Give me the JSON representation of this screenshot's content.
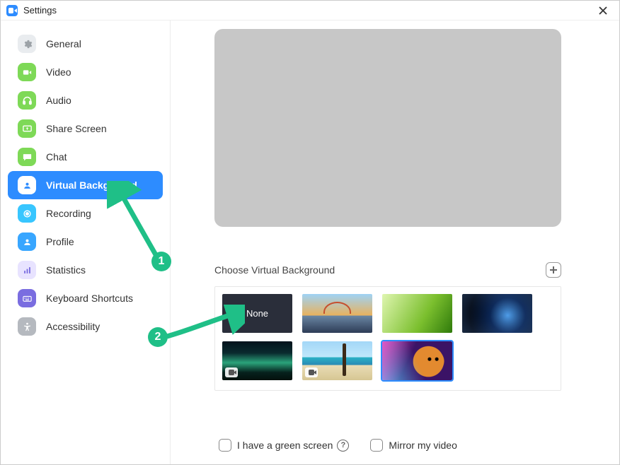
{
  "window": {
    "title": "Settings"
  },
  "sidebar": {
    "items": [
      {
        "label": "General",
        "bg": "#e9ecef",
        "fg": "#9da3a8",
        "name": "general"
      },
      {
        "label": "Video",
        "bg": "#7ed957",
        "fg": "#ffffff",
        "name": "video"
      },
      {
        "label": "Audio",
        "bg": "#7ed957",
        "fg": "#ffffff",
        "name": "audio"
      },
      {
        "label": "Share Screen",
        "bg": "#7ed957",
        "fg": "#ffffff",
        "name": "share-screen"
      },
      {
        "label": "Chat",
        "bg": "#7ed957",
        "fg": "#ffffff",
        "name": "chat"
      },
      {
        "label": "Virtual Background",
        "bg": "#ffffff",
        "fg": "#2d8cff",
        "name": "virtual-background",
        "selected": true
      },
      {
        "label": "Recording",
        "bg": "#38c6ff",
        "fg": "#ffffff",
        "name": "recording"
      },
      {
        "label": "Profile",
        "bg": "#38a6ff",
        "fg": "#ffffff",
        "name": "profile"
      },
      {
        "label": "Statistics",
        "bg": "#e8e3ff",
        "fg": "#7a6de0",
        "name": "statistics"
      },
      {
        "label": "Keyboard Shortcuts",
        "bg": "#7a6de0",
        "fg": "#ffffff",
        "name": "keyboard-shortcuts"
      },
      {
        "label": "Accessibility",
        "bg": "#b5b9bf",
        "fg": "#ffffff",
        "name": "accessibility"
      }
    ]
  },
  "content": {
    "section_title": "Choose Virtual Background",
    "none_label": "None",
    "thumbs": {
      "row1": [
        {
          "name": "bg-none",
          "kind": "none"
        },
        {
          "name": "bg-bridge",
          "class": "th-bridge"
        },
        {
          "name": "bg-grass",
          "class": "th-grass"
        },
        {
          "name": "bg-earth",
          "class": "th-earth"
        }
      ],
      "row2": [
        {
          "name": "bg-aurora",
          "class": "th-aurora",
          "video": true
        },
        {
          "name": "bg-beach",
          "class": "th-beach",
          "video": true
        },
        {
          "name": "bg-tiger",
          "class": "th-tiger",
          "selected": true
        }
      ]
    }
  },
  "options": {
    "green_screen_label": "I have a green screen",
    "mirror_label": "Mirror my video"
  },
  "annotations": {
    "badge1": "1",
    "badge2": "2"
  }
}
